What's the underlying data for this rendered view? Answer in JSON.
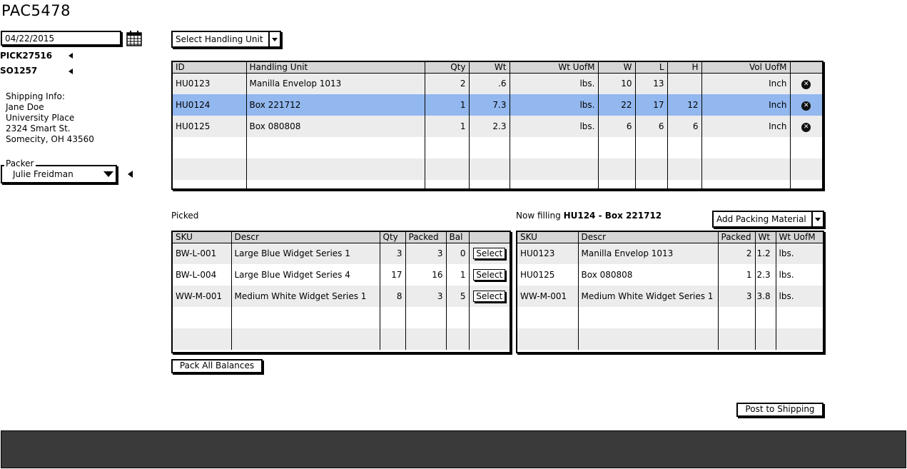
{
  "page": {
    "title": "PAC5478"
  },
  "left": {
    "date": "04/22/2015",
    "pick": "PICK27516",
    "so": "SO1257",
    "shipping": {
      "heading": "Shipping Info:",
      "name": "Jane Doe",
      "place": "University Place",
      "street": "2324 Smart St.",
      "city": "Somecity, OH  43560"
    },
    "packer": {
      "label": "Packer",
      "value": "Julie Freidman"
    }
  },
  "handling": {
    "dropdown_label": "Select Handling Unit",
    "columns": [
      "ID",
      "Handling Unit",
      "Qty",
      "Wt",
      "Wt UofM",
      "W",
      "L",
      "H",
      "Vol UofM",
      ""
    ],
    "rows": [
      {
        "id": "HU0123",
        "unit": "Manilla Envelop 1013",
        "qty": "2",
        "wt": ".6",
        "wtu": "lbs.",
        "w": "10",
        "l": "13",
        "h": "",
        "vol": "Inch"
      },
      {
        "id": "HU0124",
        "unit": "Box 221712",
        "qty": "1",
        "wt": "7.3",
        "wtu": "lbs.",
        "w": "22",
        "l": "17",
        "h": "12",
        "vol": "Inch"
      },
      {
        "id": "HU0125",
        "unit": "Box 080808",
        "qty": "1",
        "wt": "2.3",
        "wtu": "lbs.",
        "w": "6",
        "l": "6",
        "h": "6",
        "vol": "Inch"
      }
    ],
    "selected_index": 1
  },
  "picked": {
    "heading": "Picked",
    "columns": [
      "SKU",
      "Descr",
      "Qty",
      "Packed",
      "Bal",
      ""
    ],
    "select_label": "Select",
    "rows": [
      {
        "sku": "BW-L-001",
        "descr": "Large Blue Widget Series 1",
        "qty": "3",
        "packed": "3",
        "bal": "0"
      },
      {
        "sku": "BW-L-004",
        "descr": "Large Blue Widget Series 4",
        "qty": "17",
        "packed": "16",
        "bal": "1"
      },
      {
        "sku": "WW-M-001",
        "descr": "Medium White Widget Series 1",
        "qty": "8",
        "packed": "3",
        "bal": "5"
      }
    ],
    "pack_all_label": "Pack All Balances"
  },
  "filling": {
    "prefix": "Now filling",
    "target": "HU124 - Box 221712",
    "dropdown_label": "Add Packing Material",
    "columns": [
      "SKU",
      "Descr",
      "Packed",
      "Wt",
      "Wt UofM"
    ],
    "rows": [
      {
        "sku": "HU0123",
        "descr": "Manilla Envelop 1013",
        "packed": "2",
        "wt": "1.2",
        "wtu": "lbs."
      },
      {
        "sku": "HU0125",
        "descr": "Box 080808",
        "packed": "1",
        "wt": "2.3",
        "wtu": "lbs."
      },
      {
        "sku": "WW-M-001",
        "descr": "Medium White Widget Series 1",
        "packed": "3",
        "wt": "3.8",
        "wtu": "lbs."
      }
    ]
  },
  "actions": {
    "post_label": "Post to Shipping"
  },
  "colors": {
    "selected_row": "#93b8ef",
    "header_bg": "#d6d6d6",
    "stripe": "#ececec",
    "footer": "#3a3a3a"
  }
}
